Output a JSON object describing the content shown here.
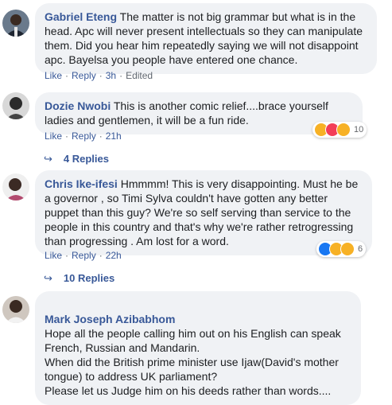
{
  "comments": [
    {
      "author": "Gabriel Eteng",
      "text": "The matter is not big grammar but what is in the head. Apc will never present intellectuals so they can manipulate them. Did you hear him repeatedly saying we will not disappoint apc. Bayelsa you people have entered one chance.",
      "like": "Like",
      "reply": "Reply",
      "time": "3h",
      "edited": "Edited"
    },
    {
      "author": "Dozie Nwobi",
      "text": "This is another comic relief....brace yourself ladies and gentlemen, it will be a fun ride.",
      "like": "Like",
      "reply": "Reply",
      "time": "21h",
      "reaction_count": "10",
      "replies": "4 Replies"
    },
    {
      "author": "Chris Ike-ifesi",
      "text": "Hmmmm! This is very disappointing. Must he be a governor , so Timi Sylva couldn't have gotten any better puppet than this guy? We're so self serving than service to the people in this country and that's why we're rather retrogressing than progressing . Am lost for a word.",
      "like": "Like",
      "reply": "Reply",
      "time": "22h",
      "reaction_count": "6",
      "replies": "10 Replies"
    },
    {
      "author": "Mark Joseph Azibabhom",
      "text": "Hope all the people calling him out on his English can speak French, Russian and Mandarin.\nWhen did the British prime minister use Ijaw(David's mother tongue) to address UK parliament?\nPlease let us Judge him on his deeds rather than words...."
    }
  ],
  "separator": "·",
  "reply_arrow": "↪"
}
